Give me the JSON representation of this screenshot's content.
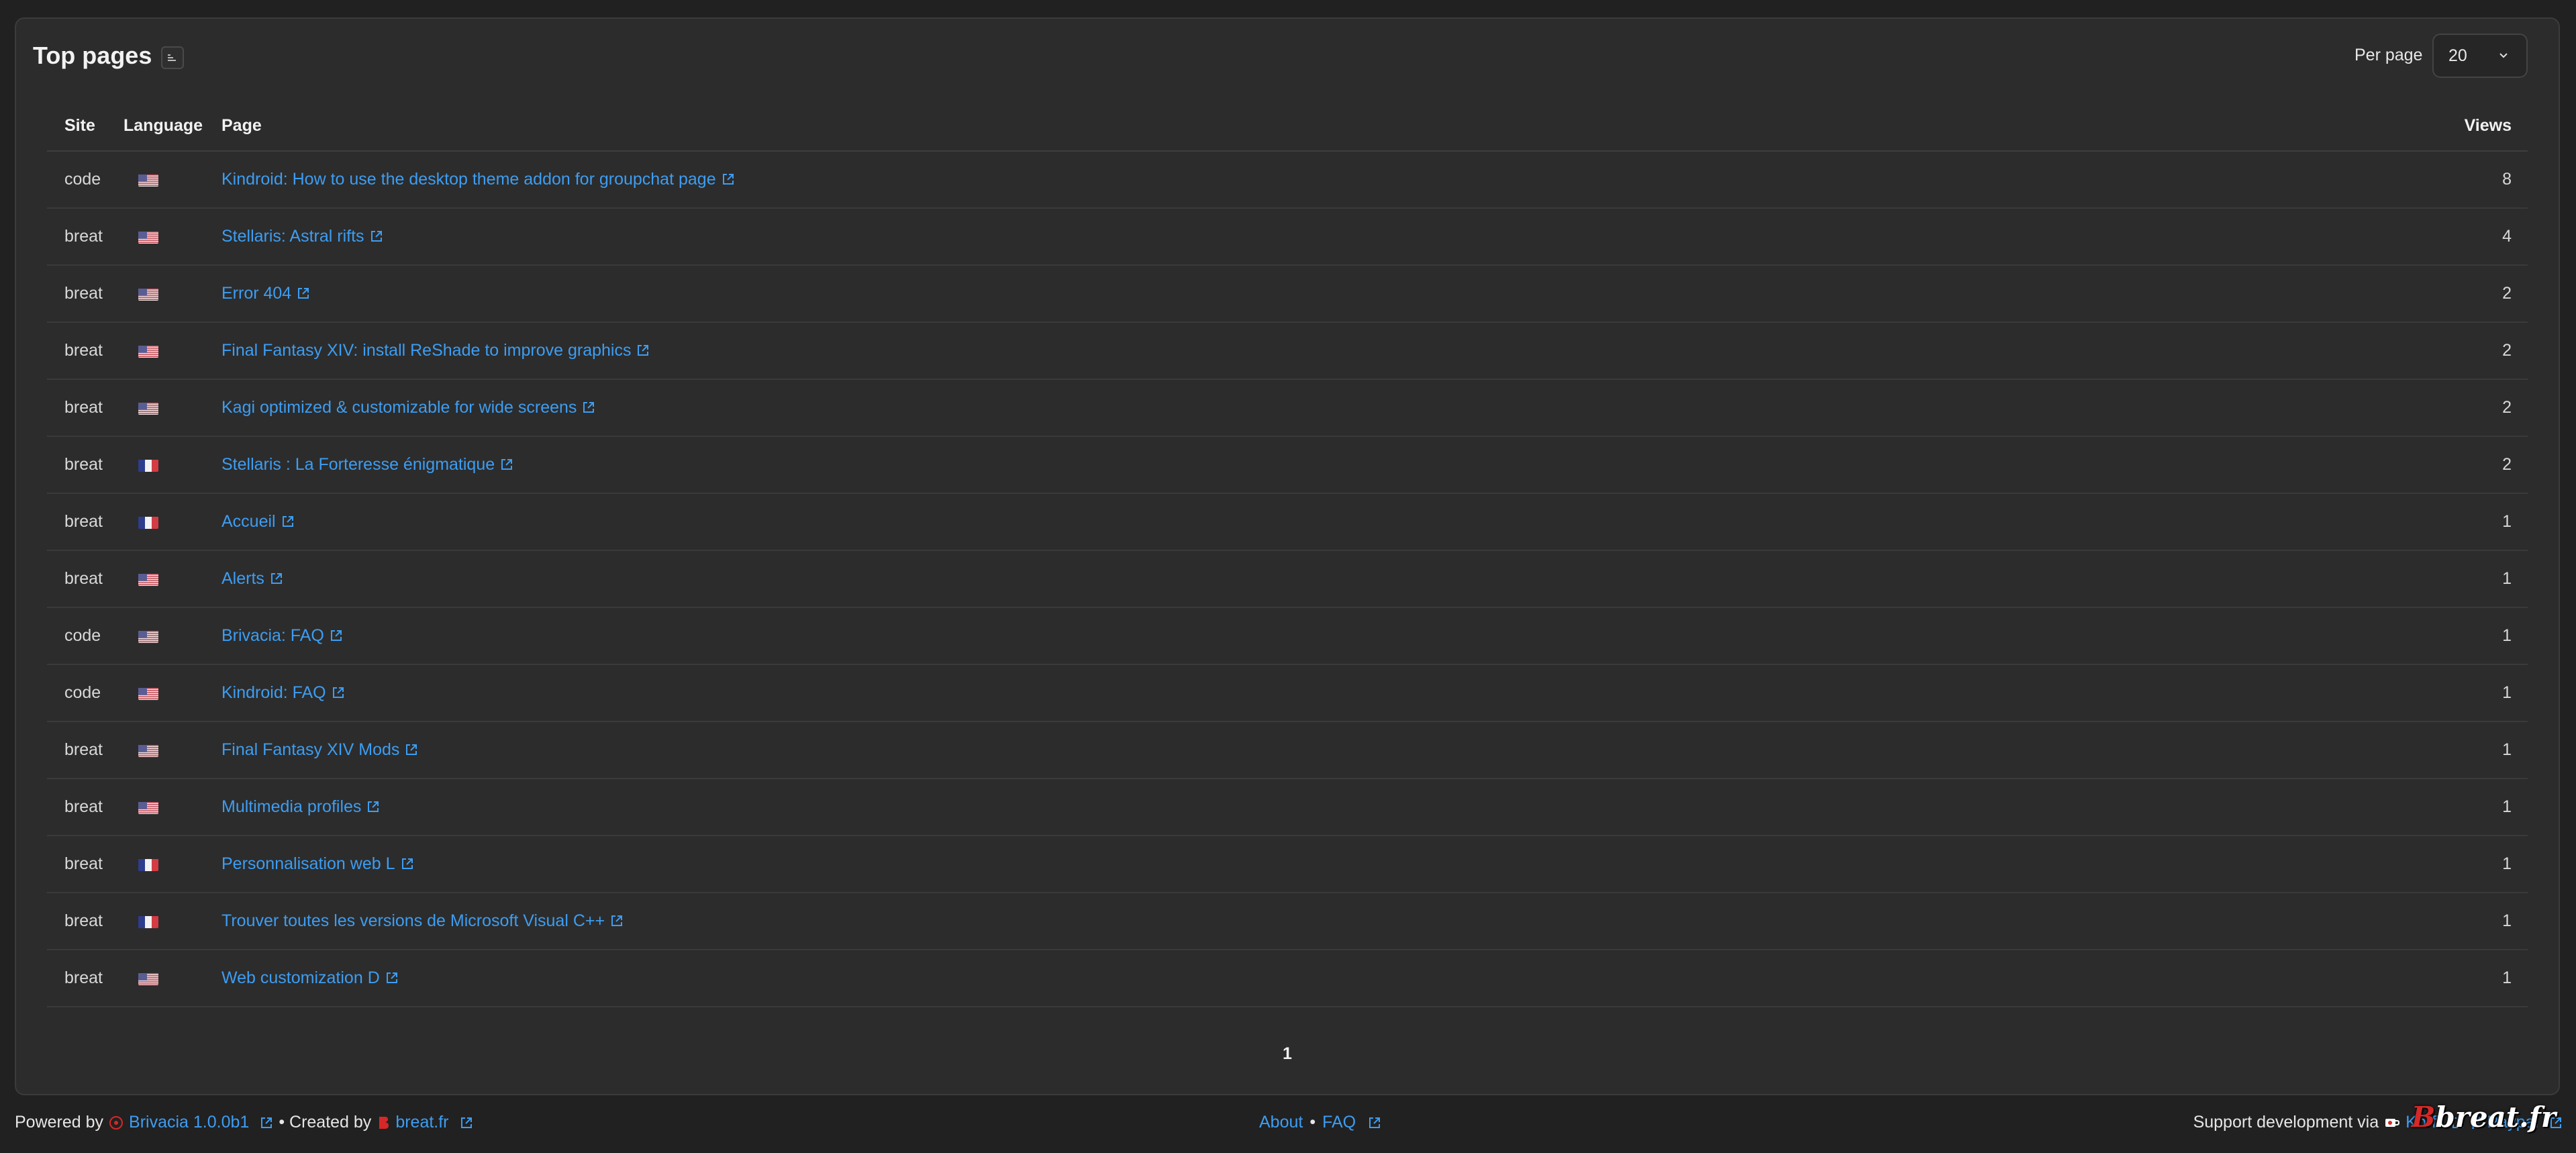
{
  "card": {
    "title": "Top pages",
    "per_page_label": "Per page",
    "per_page_value": "20"
  },
  "table": {
    "headers": {
      "site": "Site",
      "language": "Language",
      "page": "Page",
      "views": "Views"
    },
    "rows": [
      {
        "site": "code",
        "lang": "us",
        "page": "Kindroid: How to use the desktop theme addon for groupchat page",
        "views": "8"
      },
      {
        "site": "breat",
        "lang": "us",
        "page": "Stellaris: Astral rifts",
        "views": "4"
      },
      {
        "site": "breat",
        "lang": "us",
        "page": "Error 404",
        "views": "2"
      },
      {
        "site": "breat",
        "lang": "us",
        "page": "Final Fantasy XIV: install ReShade to improve graphics",
        "views": "2"
      },
      {
        "site": "breat",
        "lang": "us",
        "page": "Kagi optimized & customizable for wide screens",
        "views": "2"
      },
      {
        "site": "breat",
        "lang": "fr",
        "page": "Stellaris : La Forteresse énigmatique",
        "views": "2"
      },
      {
        "site": "breat",
        "lang": "fr",
        "page": "Accueil",
        "views": "1"
      },
      {
        "site": "breat",
        "lang": "us",
        "page": "Alerts",
        "views": "1"
      },
      {
        "site": "code",
        "lang": "us",
        "page": "Brivacia: FAQ",
        "views": "1"
      },
      {
        "site": "code",
        "lang": "us",
        "page": "Kindroid: FAQ",
        "views": "1"
      },
      {
        "site": "breat",
        "lang": "us",
        "page": "Final Fantasy XIV Mods",
        "views": "1"
      },
      {
        "site": "breat",
        "lang": "us",
        "page": "Multimedia profiles",
        "views": "1"
      },
      {
        "site": "breat",
        "lang": "fr",
        "page": "Personnalisation web L",
        "views": "1"
      },
      {
        "site": "breat",
        "lang": "fr",
        "page": "Trouver toutes les versions de Microsoft Visual C++",
        "views": "1"
      },
      {
        "site": "breat",
        "lang": "us",
        "page": "Web customization D",
        "views": "1"
      }
    ]
  },
  "pagination": {
    "current": "1"
  },
  "footer": {
    "powered_by": "Powered by",
    "brivacia_link": "Brivacia 1.0.0b1",
    "created_by": "• Created by",
    "breat_link": "breat.fr",
    "about_link": "About",
    "separator": "•",
    "faq_link": "FAQ",
    "support_text": "Support development via",
    "kofi_link": "Ko-fi",
    "paypal_link": "Paypal"
  },
  "logo_text": {
    "b": "B",
    "rest": "breat.fr"
  },
  "colors": {
    "background": "#212121",
    "card": "#2c2c2c",
    "link": "#3d9df2",
    "brand_red": "#d62828"
  }
}
